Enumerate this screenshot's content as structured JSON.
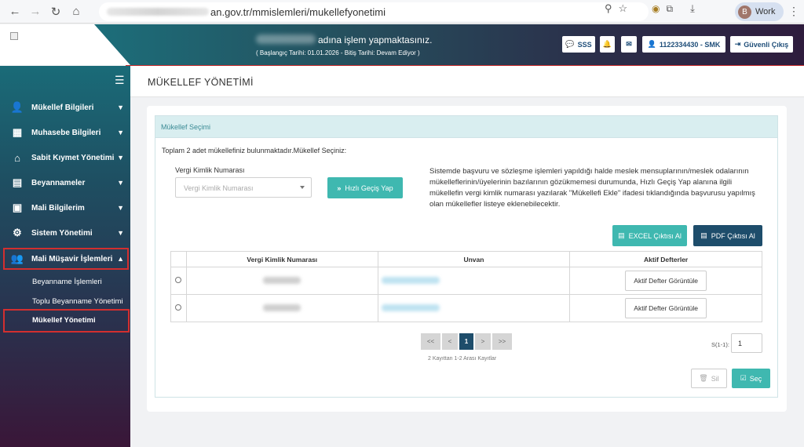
{
  "browser": {
    "url_visible": "an.gov.tr/mmislemleri/mukellefyonetimi",
    "profile_initial": "B",
    "profile_label": "Work",
    "icons": [
      "back-icon",
      "forward-icon",
      "reload-icon",
      "home-icon",
      "zoom-icon",
      "star-icon",
      "extension-icon",
      "puzzle-icon",
      "download-icon",
      "menu-icon"
    ]
  },
  "header": {
    "title": "adına işlem yapmaktasınız.",
    "subtitle": "( Başlangıç Tarihi: 01.01.2026 - Bitiş Tarihi: Devam Ediyor )",
    "buttons": {
      "sss": "SSS",
      "user_id": "1122334430 - SMK",
      "logout": "Güvenli Çıkış"
    }
  },
  "sidebar": {
    "items": [
      {
        "label": "Mükellef Bilgileri",
        "icon": "user-icon"
      },
      {
        "label": "Muhasebe Bilgileri",
        "icon": "calculator-icon"
      },
      {
        "label": "Sabit Kıymet Yönetimi",
        "icon": "home-icon"
      },
      {
        "label": "Beyannameler",
        "icon": "document-icon"
      },
      {
        "label": "Mali Bilgilerim",
        "icon": "briefcase-icon"
      },
      {
        "label": "Sistem Yönetimi",
        "icon": "gear-icon"
      },
      {
        "label": "Mali Müşavir İşlemleri",
        "icon": "users-icon"
      }
    ],
    "subitems": [
      "Beyanname İşlemleri",
      "Toplu Beyanname Yönetimi",
      "Mükellef Yönetimi"
    ]
  },
  "page": {
    "title": "MÜKELLEF YÖNETİMİ",
    "panel_title": "Mükellef Seçimi",
    "summary": "Toplam 2 adet mükellefiniz bulunmaktadır.Mükellef Seçiniz:",
    "vkn_label": "Vergi Kimlik Numarası",
    "vkn_placeholder": "Vergi Kimlik Numarası",
    "quick_button": "Hızlı Geçiş Yap",
    "info_text": "Sistemde başvuru ve sözleşme işlemleri yapıldığı halde meslek mensuplarının/meslek odalarının mükelleflerinin/üyelerinin bazılarının gözükmemesi durumunda, Hızlı Geçiş Yap alanına ilgili mükellefin vergi kimlik numarası yazılarak \"Mükellefi Ekle\" ifadesi tıklandığında başvurusu yapılmış olan mükellefler listeye eklenebilecektir.",
    "excel_button": "EXCEL Çıktısı Al",
    "pdf_button": "PDF Çıktısı Al"
  },
  "table": {
    "headers": [
      "",
      "Vergi Kimlik Numarası",
      "Unvan",
      "Aktif Defterler"
    ],
    "rows": [
      {
        "action": "Aktif Defter Görüntüle"
      },
      {
        "action": "Aktif Defter Görüntüle"
      }
    ]
  },
  "pager": {
    "first": "<<",
    "prev": "<",
    "current": "1",
    "next": ">",
    "last": ">>",
    "info": "2 Kayıttan 1-2 Arası Kayıtlar",
    "s_label": "S(1-1):",
    "s_value": "1"
  },
  "actions": {
    "delete": "Sil",
    "select": "Seç"
  },
  "colors": {
    "teal": "#3fb8b0",
    "navy": "#1e4d6b",
    "highlight": "#d32f2f"
  }
}
